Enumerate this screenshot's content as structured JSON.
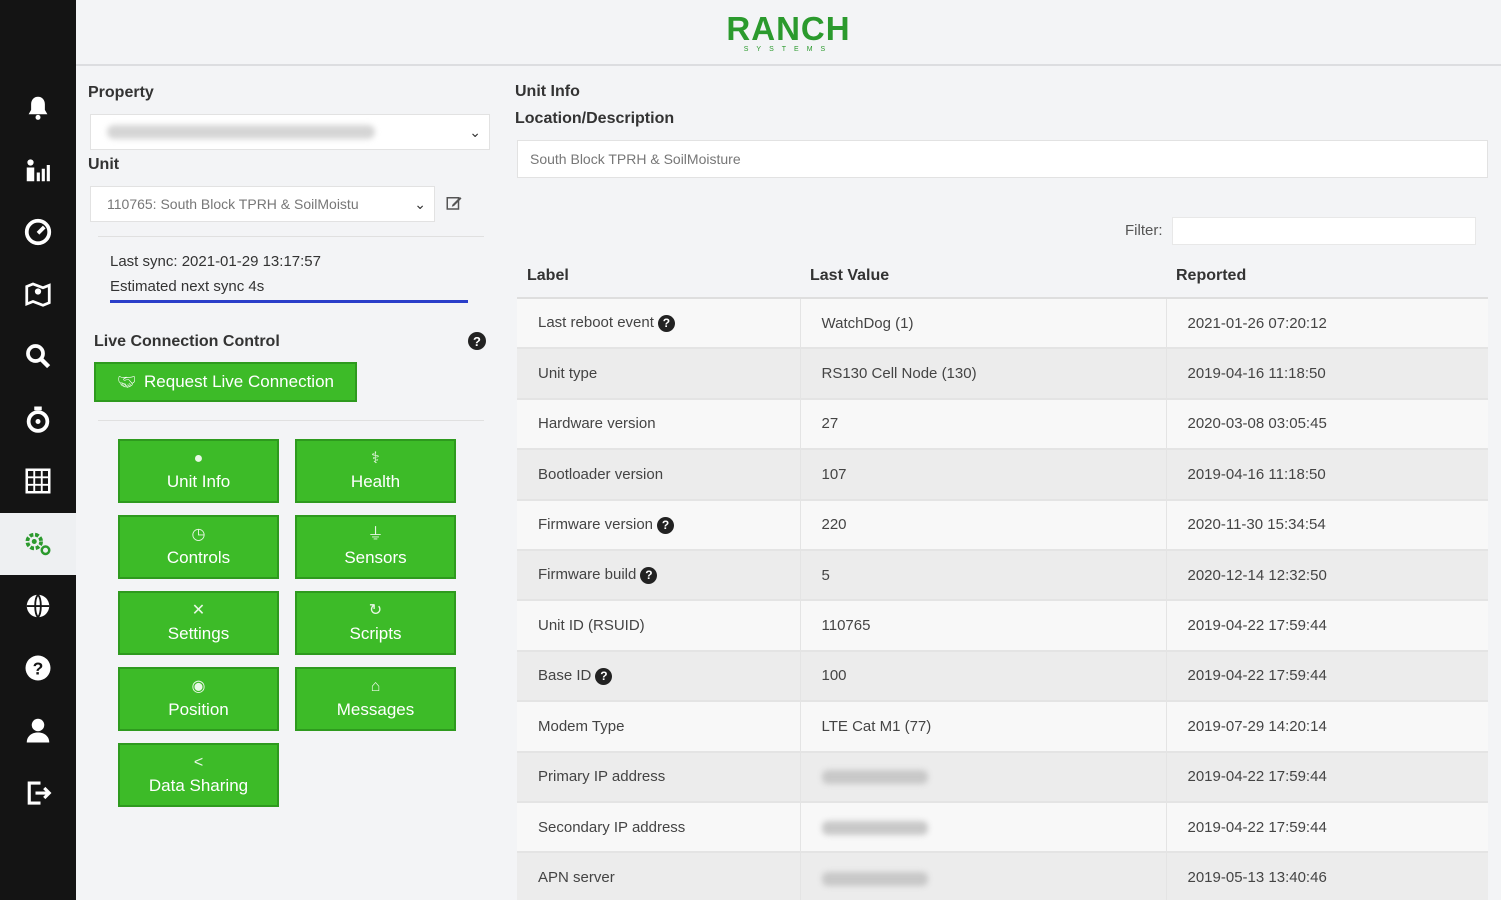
{
  "brand": {
    "name": "RANCH",
    "sub": "SYSTEMS",
    "color": "#2b9a2d"
  },
  "sidebar": {
    "items": [
      {
        "icon": "bell-icon",
        "active": false
      },
      {
        "icon": "users-chart-icon",
        "active": false
      },
      {
        "icon": "dashboard-gauge-icon",
        "active": false
      },
      {
        "icon": "map-icon",
        "active": false
      },
      {
        "icon": "search-icon",
        "active": false
      },
      {
        "icon": "stopwatch-icon",
        "active": false
      },
      {
        "icon": "report-grid-icon",
        "active": false
      },
      {
        "icon": "settings-gears-icon",
        "active": true
      },
      {
        "icon": "globe-icon",
        "active": false
      },
      {
        "icon": "help-icon",
        "active": false
      },
      {
        "icon": "user-icon",
        "active": false
      },
      {
        "icon": "logout-icon",
        "active": false
      }
    ]
  },
  "left": {
    "property_label": "Property",
    "unit_label": "Unit",
    "unit_value": "110765: South Block TPRH & SoilMoistu",
    "last_sync": "Last sync: 2021-01-29 13:17:57",
    "next_sync": "Estimated next sync 4s",
    "live_label": "Live Connection Control",
    "live_button": "Request Live Connection",
    "buttons": [
      {
        "label": "Unit Info",
        "icon": "info-icon"
      },
      {
        "label": "Health",
        "icon": "stethoscope-icon"
      },
      {
        "label": "Controls",
        "icon": "timer-icon"
      },
      {
        "label": "Sensors",
        "icon": "plug-icon"
      },
      {
        "label": "Settings",
        "icon": "tools-icon"
      },
      {
        "label": "Scripts",
        "icon": "refresh-icon"
      },
      {
        "label": "Position",
        "icon": "globe-icon"
      },
      {
        "label": "Messages",
        "icon": "inbox-icon"
      },
      {
        "label": "Data Sharing",
        "icon": "share-icon"
      }
    ]
  },
  "right": {
    "unit_info_label": "Unit Info",
    "location_label": "Location/Description",
    "location_value": "South Block TPRH & SoilMoisture",
    "filter_label": "Filter:",
    "columns": [
      "Label",
      "Last Value",
      "Reported"
    ],
    "rows": [
      {
        "label": "Last reboot event",
        "help": true,
        "value": "WatchDog (1)",
        "blurred": false,
        "reported": "2021-01-26 07:20:12"
      },
      {
        "label": "Unit type",
        "help": false,
        "value": "RS130 Cell Node (130)",
        "blurred": false,
        "reported": "2019-04-16 11:18:50"
      },
      {
        "label": "Hardware version",
        "help": false,
        "value": "27",
        "blurred": false,
        "reported": "2020-03-08 03:05:45"
      },
      {
        "label": "Bootloader version",
        "help": false,
        "value": "107",
        "blurred": false,
        "reported": "2019-04-16 11:18:50"
      },
      {
        "label": "Firmware version",
        "help": true,
        "value": "220",
        "blurred": false,
        "reported": "2020-11-30 15:34:54"
      },
      {
        "label": "Firmware build",
        "help": true,
        "value": "5",
        "blurred": false,
        "reported": "2020-12-14 12:32:50"
      },
      {
        "label": "Unit ID (RSUID)",
        "help": false,
        "value": "110765",
        "blurred": false,
        "reported": "2019-04-22 17:59:44"
      },
      {
        "label": "Base ID",
        "help": true,
        "value": "100",
        "blurred": false,
        "reported": "2019-04-22 17:59:44"
      },
      {
        "label": "Modem Type",
        "help": false,
        "value": "LTE Cat M1 (77)",
        "blurred": false,
        "reported": "2019-07-29 14:20:14"
      },
      {
        "label": "Primary IP address",
        "help": false,
        "value": "",
        "blurred": true,
        "reported": "2019-04-22 17:59:44"
      },
      {
        "label": "Secondary IP address",
        "help": false,
        "value": "",
        "blurred": true,
        "reported": "2019-04-22 17:59:44"
      },
      {
        "label": "APN server",
        "help": false,
        "value": "",
        "blurred": true,
        "reported": "2019-05-13 13:40:46"
      }
    ]
  }
}
